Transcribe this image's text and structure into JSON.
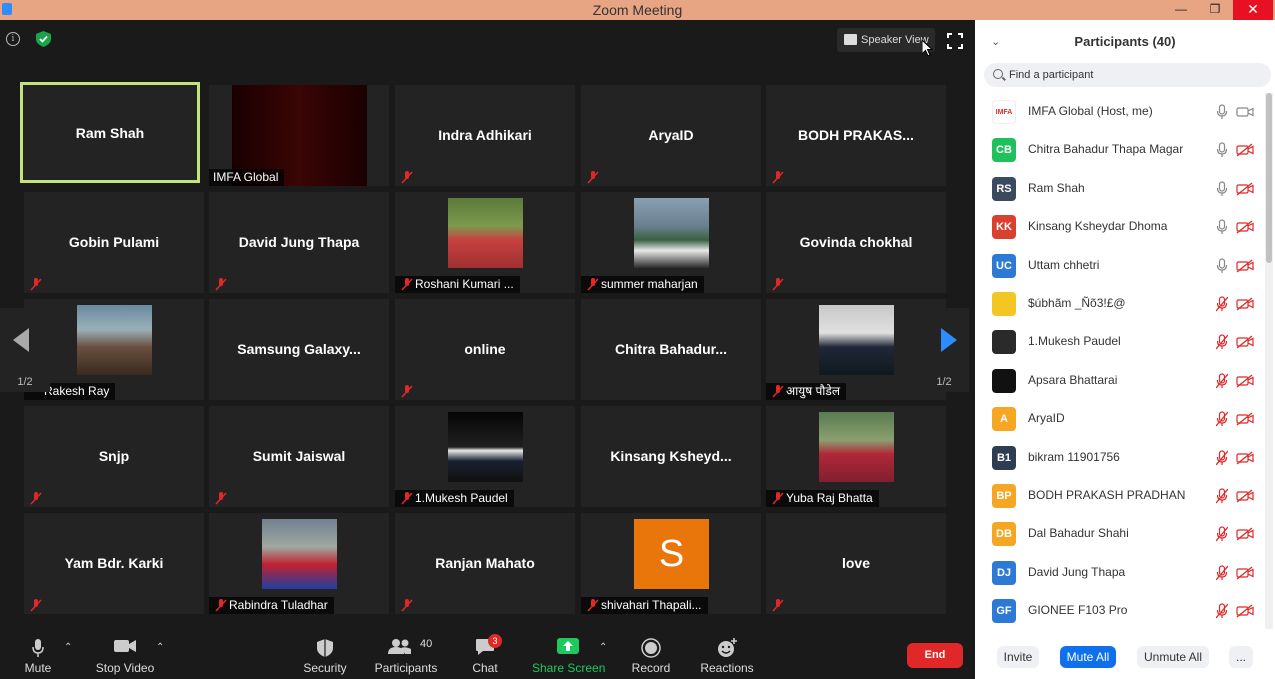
{
  "window": {
    "title": "Zoom Meeting",
    "minimize": "—",
    "restore": "❐",
    "close": "✕"
  },
  "top": {
    "speaker_view": "Speaker View",
    "info": "i"
  },
  "nav": {
    "prev_page": "1/2",
    "next_page": "1/2"
  },
  "tiles": [
    {
      "name": "Ram Shah"
    },
    {
      "label": "IMFA Global"
    },
    {
      "name": "Indra Adhikari"
    },
    {
      "name": "AryaID"
    },
    {
      "name": "BODH  PRAKAS..."
    },
    {
      "name": "Gobin Pulami"
    },
    {
      "name": "David Jung Thapa"
    },
    {
      "label": "Roshani Kumari ..."
    },
    {
      "label": "summer maharjan"
    },
    {
      "name": "Govinda chokhal"
    },
    {
      "label": "Rakesh Ray"
    },
    {
      "name": "Samsung  Galaxy..."
    },
    {
      "name": "online"
    },
    {
      "name": "Chitra  Bahadur..."
    },
    {
      "label": "आयुष पौडेल"
    },
    {
      "name": "Snjp"
    },
    {
      "name": "Sumit Jaiswal"
    },
    {
      "label": "1.Mukesh Paudel"
    },
    {
      "name": "Kinsang  Ksheyd..."
    },
    {
      "label": "Yuba Raj Bhatta"
    },
    {
      "name": "Yam Bdr. Karki"
    },
    {
      "label": "Rabindra Tuladhar"
    },
    {
      "name": "Ranjan Mahato"
    },
    {
      "label": "shivahari Thapali...",
      "initial": "S"
    },
    {
      "name": "love"
    }
  ],
  "toolbar": {
    "mute": "Mute",
    "stop_video": "Stop Video",
    "security": "Security",
    "participants": "Participants",
    "participants_count": "40",
    "chat": "Chat",
    "chat_badge": "3",
    "share_screen": "Share Screen",
    "record": "Record",
    "reactions": "Reactions",
    "end": "End"
  },
  "panel": {
    "title": "Participants (40)",
    "search_placeholder": "Find a participant",
    "participants": [
      {
        "initials": "IMFA",
        "name": "IMFA Global (Host, me)",
        "color": "#ffffff"
      },
      {
        "initials": "CB",
        "name": "Chitra Bahadur Thapa Magar",
        "color": "#20c05c"
      },
      {
        "initials": "RS",
        "name": "Ram Shah",
        "color": "#3b4a5e"
      },
      {
        "initials": "KK",
        "name": "Kinsang Ksheydar Dhoma",
        "color": "#d8412f"
      },
      {
        "initials": "UC",
        "name": "Uttam chhetri",
        "color": "#2d7ad6"
      },
      {
        "initials": "",
        "name": "$úbhãm _Ñõ3!£@",
        "color": "#f3c623"
      },
      {
        "initials": "",
        "name": "1.Mukesh Paudel",
        "color": "#2a2a2a"
      },
      {
        "initials": "",
        "name": "Apsara Bhattarai",
        "color": "#111111"
      },
      {
        "initials": "A",
        "name": "AryaID",
        "color": "#f5a623"
      },
      {
        "initials": "B1",
        "name": "bikram 11901756",
        "color": "#2f3d52"
      },
      {
        "initials": "BP",
        "name": "BODH PRAKASH PRADHAN",
        "color": "#f5a623"
      },
      {
        "initials": "DB",
        "name": "Dal Bahadur Shahi",
        "color": "#f5a623"
      },
      {
        "initials": "DJ",
        "name": "David Jung Thapa",
        "color": "#2d7ad6"
      },
      {
        "initials": "GF",
        "name": "GIONEE F103 Pro",
        "color": "#2d7ad6"
      }
    ],
    "invite": "Invite",
    "mute_all": "Mute All",
    "unmute_all": "Unmute All",
    "more": "..."
  }
}
